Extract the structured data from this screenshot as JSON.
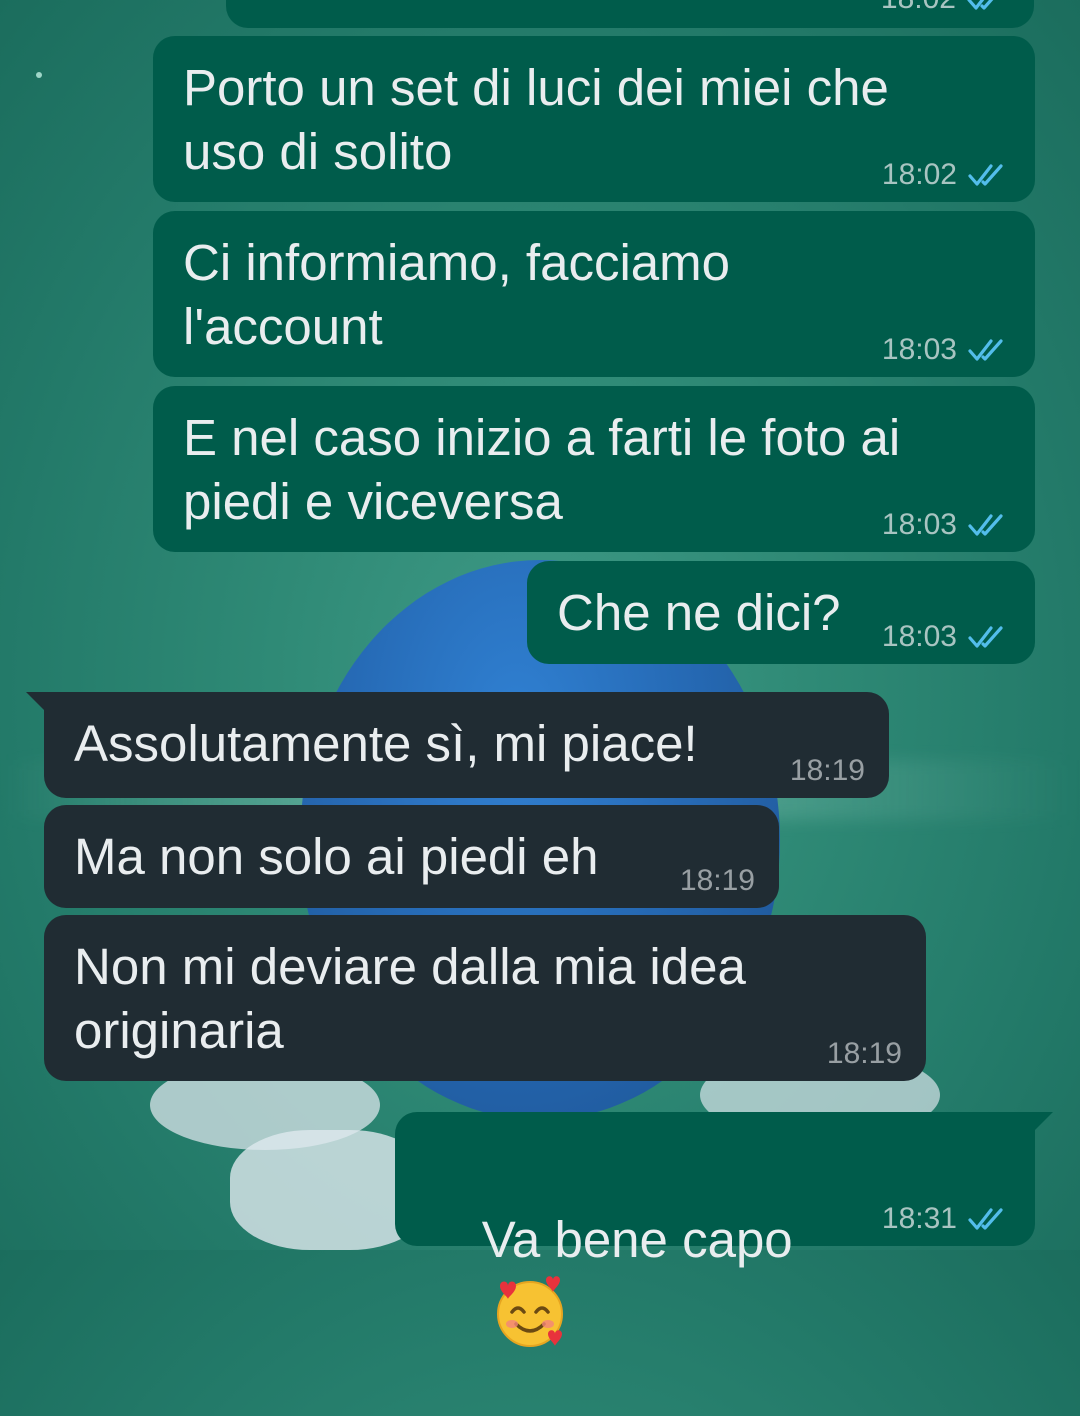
{
  "chat": {
    "messages": [
      {
        "id": "m0",
        "direction": "outgoing",
        "text": "",
        "time": "18:02",
        "status": "read-ticks-icon"
      },
      {
        "id": "m1",
        "direction": "outgoing",
        "text": "Porto un set di luci dei miei che\nuso di solito",
        "time": "18:02",
        "status": "read-ticks-icon"
      },
      {
        "id": "m2",
        "direction": "outgoing",
        "text": "Ci informiamo, facciamo\nl'account",
        "time": "18:03",
        "status": "read-ticks-icon"
      },
      {
        "id": "m3",
        "direction": "outgoing",
        "text": "E nel caso inizio a farti le foto ai\npiedi e viceversa",
        "time": "18:03",
        "status": "read-ticks-icon"
      },
      {
        "id": "m4",
        "direction": "outgoing",
        "text": "Che ne dici?",
        "time": "18:03",
        "status": "read-ticks-icon"
      },
      {
        "id": "m5",
        "direction": "incoming",
        "text": "Assolutamente sì, mi piace!",
        "time": "18:19"
      },
      {
        "id": "m6",
        "direction": "incoming",
        "text": "Ma non solo ai piedi eh",
        "time": "18:19"
      },
      {
        "id": "m7",
        "direction": "incoming",
        "text": "Non mi deviare dalla mia idea\noriginaria",
        "time": "18:19"
      },
      {
        "id": "m8",
        "direction": "outgoing",
        "text": "Va bene capo",
        "emoji": "smiling-face-with-hearts-icon",
        "time": "18:31",
        "status": "read-ticks-icon"
      }
    ]
  },
  "colors": {
    "outgoing_bubble": "#005c4b",
    "incoming_bubble": "#202c33",
    "read_ticks": "#53bdeb",
    "text": "#e9edef"
  }
}
